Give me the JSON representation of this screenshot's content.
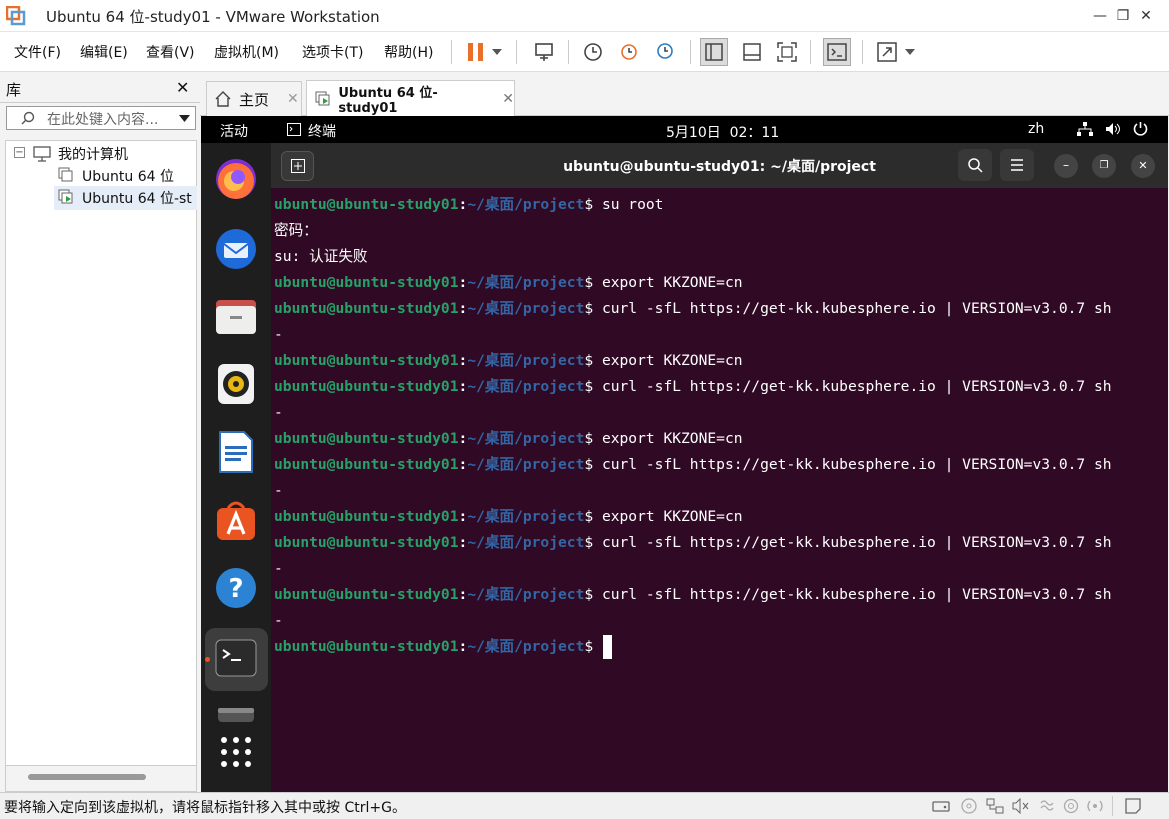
{
  "window": {
    "title": "Ubuntu 64 位-study01 - VMware Workstation"
  },
  "menu": [
    "文件(F)",
    "编辑(E)",
    "查看(V)",
    "虚拟机(M)",
    "选项卡(T)",
    "帮助(H)"
  ],
  "library": {
    "title": "库",
    "search_placeholder": "在此处键入内容...",
    "tree": {
      "root": "我的计算机",
      "items": [
        "Ubuntu 64 位",
        "Ubuntu 64 位-st"
      ]
    }
  },
  "tabs": [
    {
      "label": "主页"
    },
    {
      "label": "Ubuntu 64 位-study01"
    }
  ],
  "gnome": {
    "activities": "活动",
    "app": "终端",
    "clock": "5月10日  02：11",
    "lang": "zh"
  },
  "terminal": {
    "title": "ubuntu@ubuntu-study01: ~/桌面/project",
    "prompt_user": "ubuntu@ubuntu-study01",
    "prompt_path": "~/桌面/project",
    "lines": [
      {
        "type": "cmd",
        "text": " su root"
      },
      {
        "type": "out",
        "text": "密码："
      },
      {
        "type": "out",
        "text": "su: 认证失败"
      },
      {
        "type": "cmd",
        "text": " export KKZONE=cn"
      },
      {
        "type": "cmd",
        "text": " curl -sfL https://get-kk.kubesphere.io | VERSION=v3.0.7 sh"
      },
      {
        "type": "out",
        "text": "-"
      },
      {
        "type": "cmd",
        "text": " export KKZONE=cn"
      },
      {
        "type": "cmd",
        "text": " curl -sfL https://get-kk.kubesphere.io | VERSION=v3.0.7 sh"
      },
      {
        "type": "out",
        "text": "-"
      },
      {
        "type": "cmd",
        "text": " export KKZONE=cn"
      },
      {
        "type": "cmd",
        "text": " curl -sfL https://get-kk.kubesphere.io | VERSION=v3.0.7 sh"
      },
      {
        "type": "out",
        "text": "-"
      },
      {
        "type": "cmd",
        "text": " export KKZONE=cn"
      },
      {
        "type": "cmd",
        "text": " curl -sfL https://get-kk.kubesphere.io | VERSION=v3.0.7 sh"
      },
      {
        "type": "out",
        "text": "-"
      },
      {
        "type": "cmd",
        "text": " curl -sfL https://get-kk.kubesphere.io | VERSION=v3.0.7 sh"
      },
      {
        "type": "out",
        "text": "-"
      },
      {
        "type": "cmd",
        "text": " "
      }
    ]
  },
  "dock": [
    "firefox-icon",
    "thunderbird-icon",
    "files-icon",
    "rhythmbox-icon",
    "libreoffice-writer-icon",
    "app-center-icon",
    "help-icon",
    "terminal-icon",
    "drive-icon",
    "show-apps-icon"
  ],
  "status": {
    "message": "要将输入定向到该虚拟机，请将鼠标指针移入其中或按 Ctrl+G。"
  },
  "colors": {
    "terminal_bg": "#300a24",
    "prompt_user": "#26a269",
    "prompt_path": "#3465a4",
    "pause_orange": "#e8702a"
  }
}
